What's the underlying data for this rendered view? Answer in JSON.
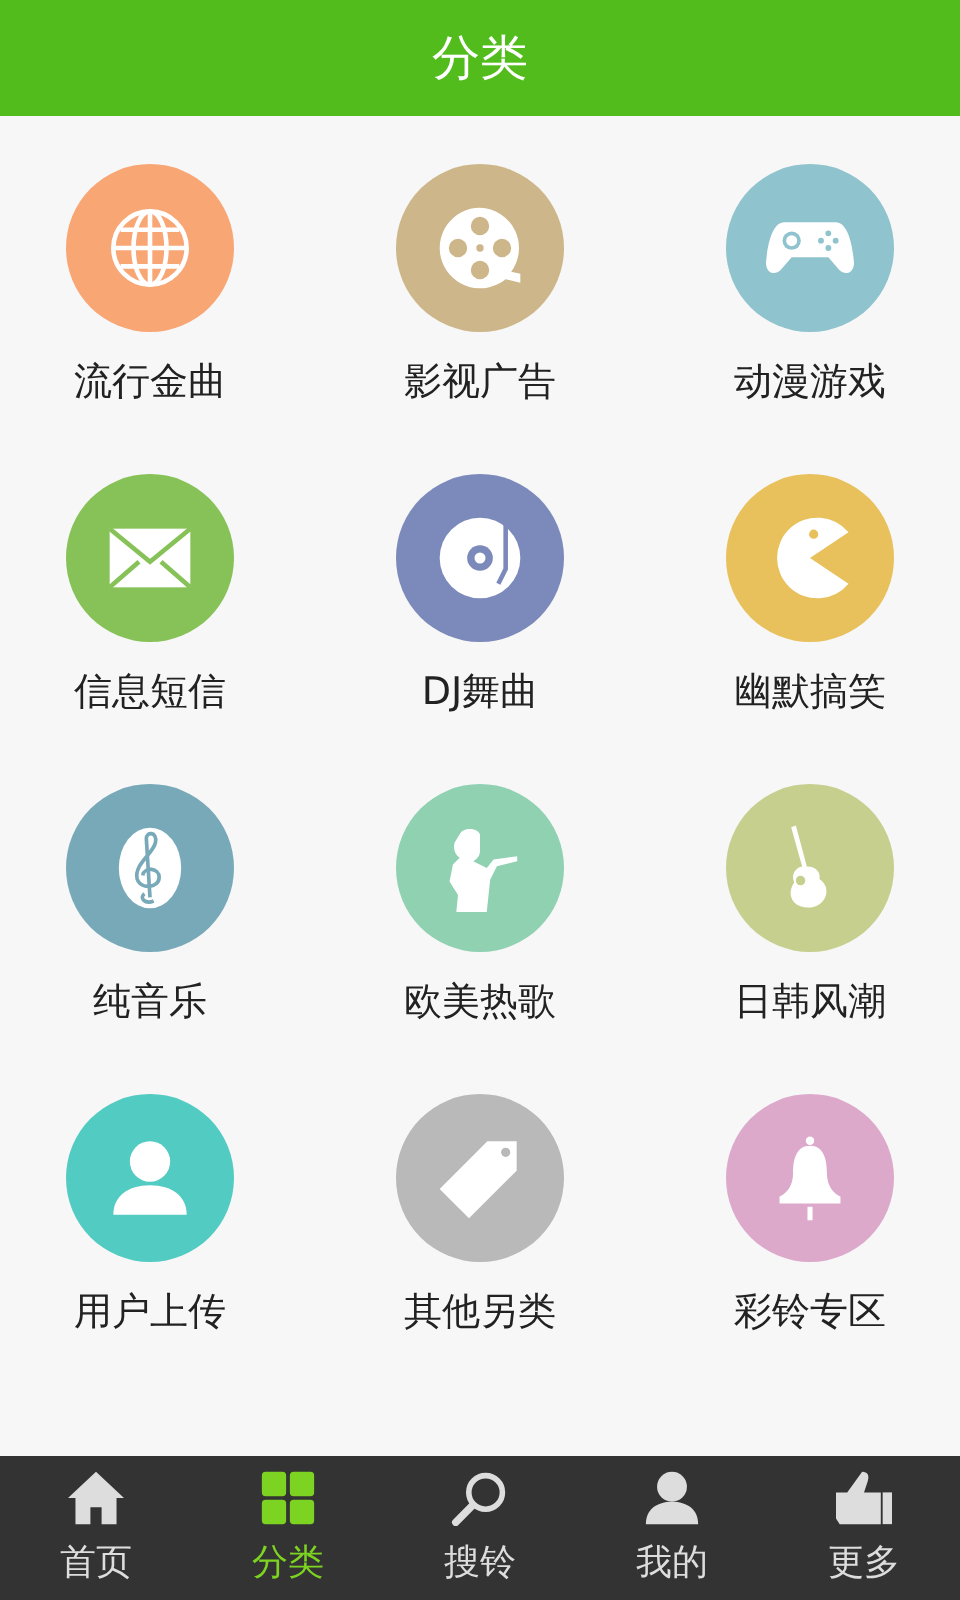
{
  "header": {
    "title": "分类"
  },
  "categories": [
    {
      "label": "流行金曲",
      "color": "#f9a675"
    },
    {
      "label": "影视广告",
      "color": "#cdb68a"
    },
    {
      "label": "动漫游戏",
      "color": "#8fc3cd"
    },
    {
      "label": "信息短信",
      "color": "#86c257"
    },
    {
      "label": "DJ舞曲",
      "color": "#7b89bb"
    },
    {
      "label": "幽默搞笑",
      "color": "#e8c05c"
    },
    {
      "label": "纯音乐",
      "color": "#78a9b8"
    },
    {
      "label": "欧美热歌",
      "color": "#8fd1b1"
    },
    {
      "label": "日韩风潮",
      "color": "#c7cf8f"
    },
    {
      "label": "用户上传",
      "color": "#52cbc2"
    },
    {
      "label": "其他另类",
      "color": "#b9b9b9"
    },
    {
      "label": "彩铃专区",
      "color": "#dca9cb"
    }
  ],
  "tabs": [
    {
      "label": "首页",
      "selected": false
    },
    {
      "label": "分类",
      "selected": true
    },
    {
      "label": "搜铃",
      "selected": false
    },
    {
      "label": "我的",
      "selected": false
    },
    {
      "label": "更多",
      "selected": false
    }
  ]
}
